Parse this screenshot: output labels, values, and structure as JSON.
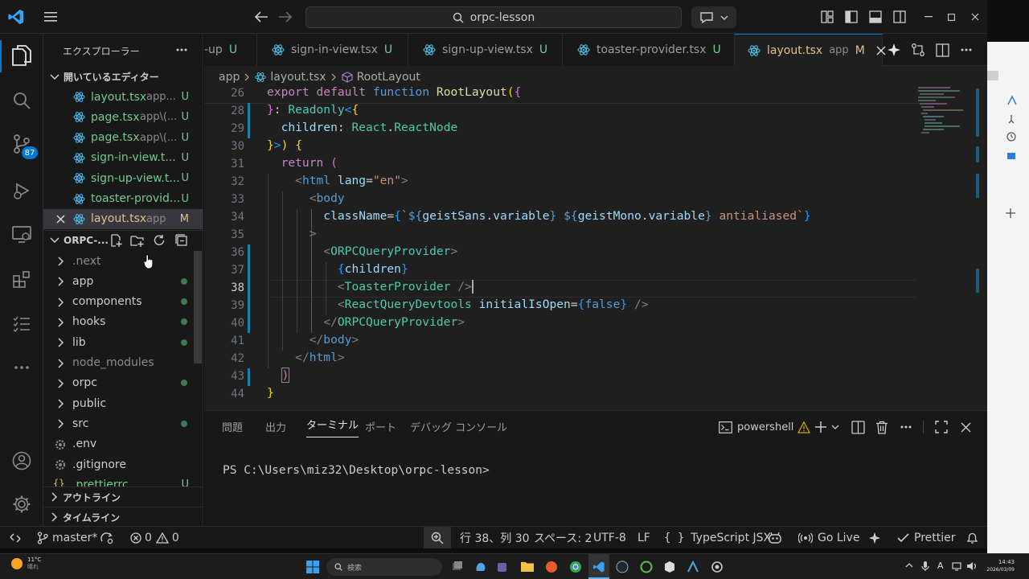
{
  "title_bar": {
    "search_text": "orpc-lesson"
  },
  "sidebar": {
    "title": "エクスプローラー",
    "open_editors_label": "開いているエディター",
    "open_editors": [
      {
        "name": "layout.tsx",
        "sub": "app...",
        "status": "U"
      },
      {
        "name": "page.tsx",
        "sub": "app\\(...",
        "status": "U"
      },
      {
        "name": "page.tsx",
        "sub": "app\\(...",
        "status": "U"
      },
      {
        "name": "sign-in-view.t...",
        "sub": "",
        "status": "U"
      },
      {
        "name": "sign-up-view.t...",
        "sub": "",
        "status": "U"
      },
      {
        "name": "toaster-provid...",
        "sub": "",
        "status": "U"
      },
      {
        "name": "layout.tsx",
        "sub": "app",
        "status": "M"
      }
    ],
    "project_label": "ORPC-...",
    "tree": [
      {
        "name": ".next"
      },
      {
        "name": "app"
      },
      {
        "name": "components"
      },
      {
        "name": "hooks"
      },
      {
        "name": "lib"
      },
      {
        "name": "node_modules"
      },
      {
        "name": "orpc"
      },
      {
        "name": "public"
      },
      {
        "name": "src"
      },
      {
        "name": ".env"
      },
      {
        "name": ".gitignore"
      },
      {
        "name": ".prettierrc",
        "status": "U"
      }
    ],
    "outline_label": "アウトライン",
    "timeline_label": "タイムライン"
  },
  "tabs": [
    {
      "name": "-up",
      "status": "U"
    },
    {
      "name": "sign-in-view.tsx",
      "status": "U"
    },
    {
      "name": "sign-up-view.tsx",
      "status": "U"
    },
    {
      "name": "toaster-provider.tsx",
      "status": "U"
    },
    {
      "name": "layout.tsx",
      "sub": "app",
      "status": "M"
    }
  ],
  "breadcrumb": {
    "folder": "app",
    "file": "layout.tsx",
    "symbol": "RootLayout"
  },
  "line_numbers": [
    "26",
    "28",
    "29",
    "30",
    "31",
    "32",
    "33",
    "34",
    "35",
    "36",
    "37",
    "38",
    "39",
    "40",
    "41",
    "42",
    "43",
    "44"
  ],
  "panel": {
    "tabs": [
      "問題",
      "出力",
      "ターミナル",
      "ポート",
      "デバッグ コンソール"
    ],
    "active_tab": "ターミナル",
    "shell": "powershell",
    "prompt": "PS C:\\Users\\miz32\\Desktop\\orpc-lesson>"
  },
  "status_bar": {
    "branch": "master*",
    "errors": "0",
    "warnings": "0",
    "position": "行 38、列 30",
    "spaces": "スペース: 2",
    "encoding": "UTF-8",
    "eol": "LF",
    "language": "TypeScript JSX",
    "go_live": "Go Live",
    "prettier": "Prettier"
  },
  "activity_bar": {
    "scm_badge": "87"
  },
  "taskbar": {
    "weather_temp": "11°C",
    "weather_desc": "晴れ",
    "search_placeholder": "検索",
    "time": "14:43",
    "date": "2026/03/09"
  },
  "colors": {
    "accent": "#0078d4",
    "untracked": "#73c991",
    "modified": "#e2c08d"
  }
}
